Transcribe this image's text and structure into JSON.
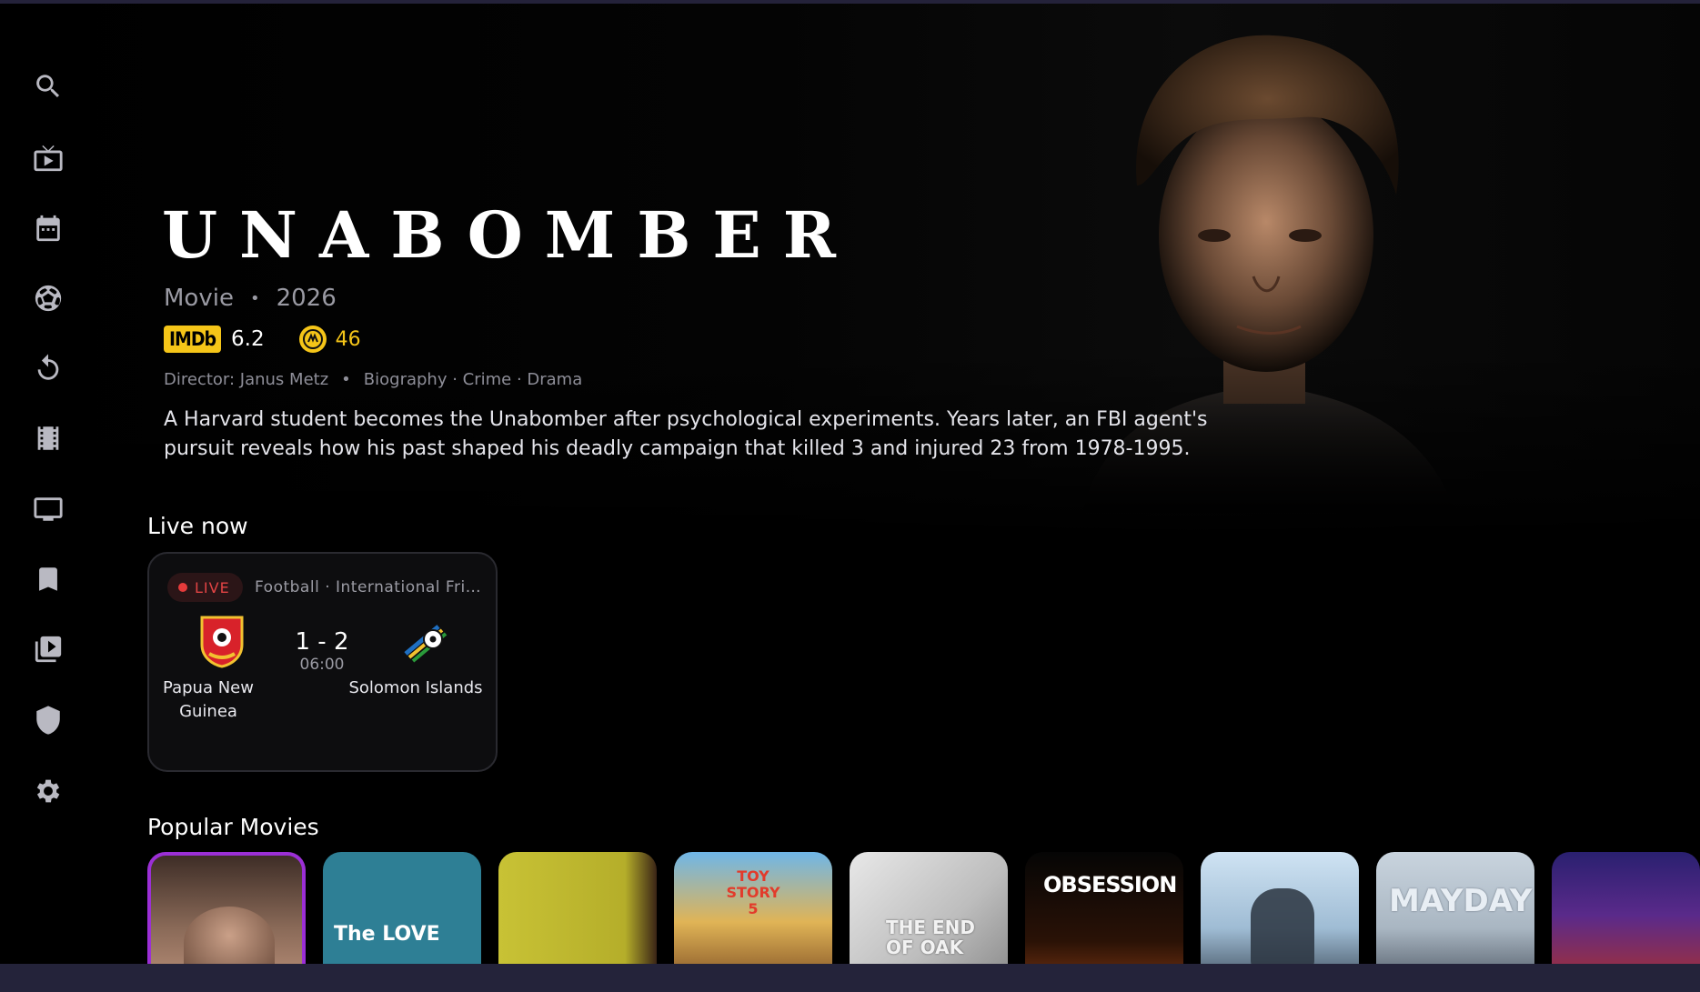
{
  "nav": {
    "items": [
      {
        "name": "search"
      },
      {
        "name": "live-tv"
      },
      {
        "name": "calendar"
      },
      {
        "name": "sports"
      },
      {
        "name": "history"
      },
      {
        "name": "movies"
      },
      {
        "name": "tv-shows"
      },
      {
        "name": "watchlist"
      },
      {
        "name": "playlists"
      },
      {
        "name": "parental-controls"
      },
      {
        "name": "settings"
      }
    ]
  },
  "hero": {
    "title": "UNABOMBER",
    "type": "Movie",
    "separator": "•",
    "year": "2026",
    "imdb_label": "IMDb",
    "imdb_rating": "6.2",
    "metacritic_score": "46",
    "director": "Director: Janus Metz",
    "genres": "Biography · Crime · Drama",
    "description": "A Harvard student becomes the Unabomber after psychological experiments. Years later, an FBI agent's pursuit reveals how his past shaped his deadly campaign that killed 3 and injured 23 from 1978-1995."
  },
  "live_now": {
    "heading": "Live now",
    "badge": "LIVE",
    "league": "Football · International Friendly",
    "home_team": "Papua New Guinea",
    "away_team": "Solomon Islands",
    "score": "1 - 2",
    "clock": "06:00"
  },
  "popular_movies": {
    "heading": "Popular Movies",
    "posters": [
      {
        "text": ""
      },
      {
        "text": "The LOVE"
      },
      {
        "text": ""
      },
      {
        "text": "TOY STORY 5"
      },
      {
        "text": "THE END OF OAK"
      },
      {
        "text": "OBSESSION"
      },
      {
        "text": ""
      },
      {
        "text": "MAYDAY"
      },
      {
        "text": ""
      }
    ]
  },
  "colors": {
    "accent_focus": "#9b2fd6",
    "imdb_yellow": "#f5c518",
    "live_red": "#e24444",
    "background": "#000000"
  }
}
